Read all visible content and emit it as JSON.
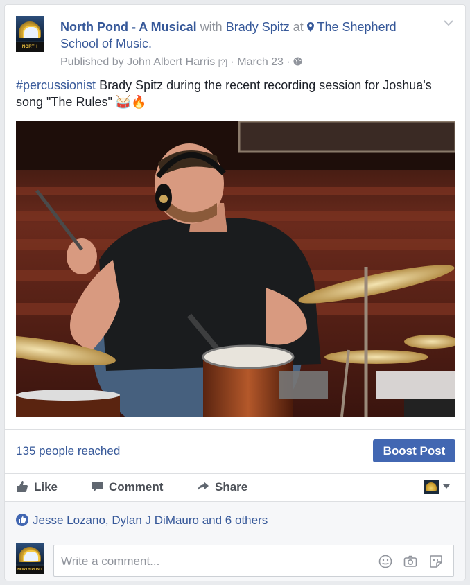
{
  "post": {
    "page_name": "North Pond - A Musical",
    "with_word": "with",
    "tagged_person": "Brady Spitz",
    "at_word": "at",
    "location": "The Shepherd School of Music.",
    "published_by": "Published by John Albert Harris",
    "help_mark": "[?]",
    "date": "· March 23 ·",
    "avatar_caption": "NORTH POND",
    "hashtag": "#percussionist",
    "text": " Brady Spitz during the recent recording session for Joshua's song \"The Rules\" 🥁🔥"
  },
  "stats": {
    "reached": "135 people reached",
    "boost_label": "Boost Post"
  },
  "actions": {
    "like": "Like",
    "comment": "Comment",
    "share": "Share"
  },
  "reactions": {
    "summary": "Jesse Lozano, Dylan J DiMauro and 6 others"
  },
  "comment_input": {
    "placeholder": "Write a comment..."
  },
  "icons": [
    "location-pin-icon",
    "globe-icon",
    "chevron-down-icon",
    "like-icon",
    "comment-icon",
    "share-icon",
    "emoji-icon",
    "camera-icon",
    "sticker-icon"
  ]
}
